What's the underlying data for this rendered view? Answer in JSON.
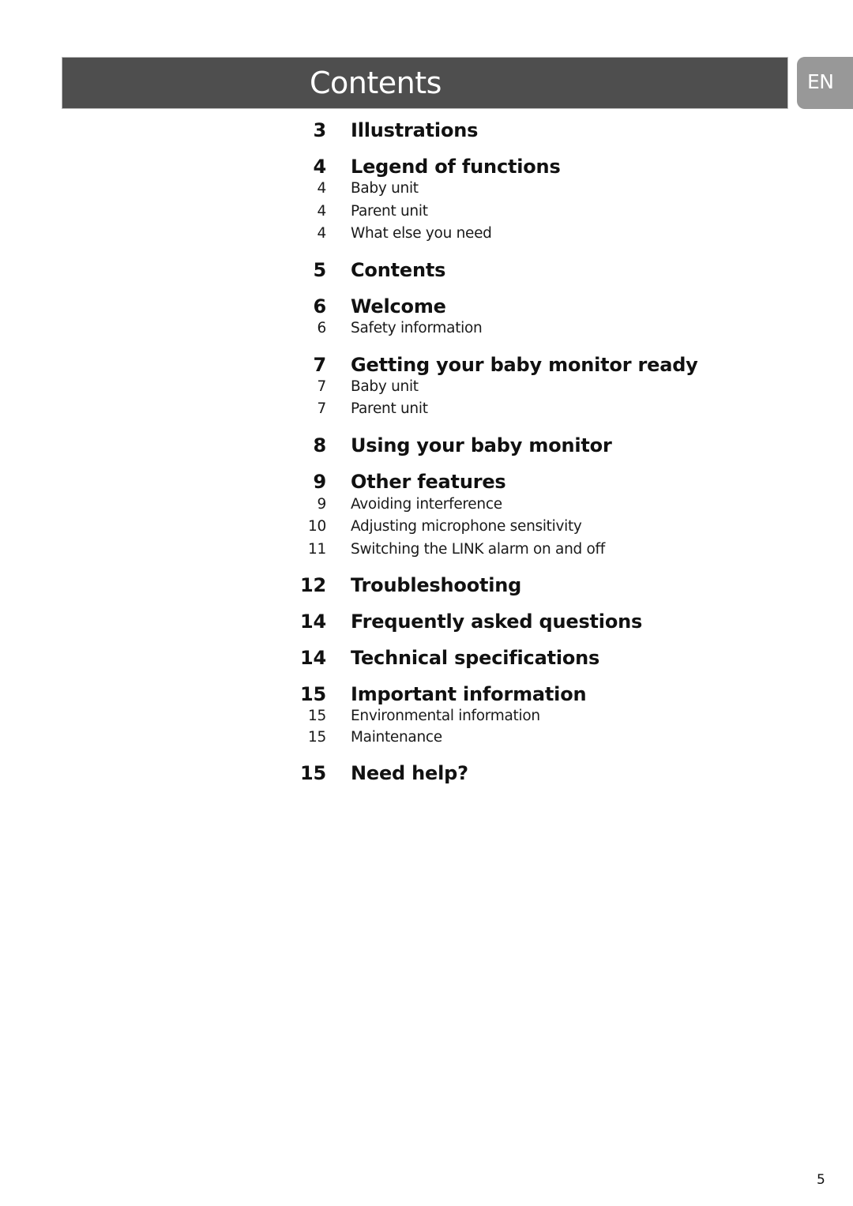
{
  "header": {
    "title": "Contents",
    "language_tab": "EN"
  },
  "toc": [
    {
      "type": "heading",
      "page": "3",
      "label": "Illustrations"
    },
    {
      "type": "heading",
      "page": "4",
      "label": "Legend of functions"
    },
    {
      "type": "sub",
      "page": "4",
      "label": "Baby unit"
    },
    {
      "type": "sub",
      "page": "4",
      "label": "Parent unit"
    },
    {
      "type": "sub",
      "page": "4",
      "label": "What else you need"
    },
    {
      "type": "heading",
      "page": "5",
      "label": "Contents"
    },
    {
      "type": "heading",
      "page": "6",
      "label": "Welcome"
    },
    {
      "type": "sub",
      "page": "6",
      "label": "Safety information"
    },
    {
      "type": "heading",
      "page": "7",
      "label": "Getting your baby monitor ready"
    },
    {
      "type": "sub",
      "page": "7",
      "label": "Baby unit"
    },
    {
      "type": "sub",
      "page": "7",
      "label": "Parent unit"
    },
    {
      "type": "heading",
      "page": "8",
      "label": "Using your baby monitor"
    },
    {
      "type": "heading",
      "page": "9",
      "label": "Other features"
    },
    {
      "type": "sub",
      "page": "9",
      "label": "Avoiding interference"
    },
    {
      "type": "sub",
      "page": "10",
      "label": "Adjusting microphone sensitivity"
    },
    {
      "type": "sub",
      "page": "11",
      "label": "Switching the LINK alarm on and off"
    },
    {
      "type": "heading",
      "page": "12",
      "label": "Troubleshooting"
    },
    {
      "type": "heading",
      "page": "14",
      "label": "Frequently asked questions"
    },
    {
      "type": "heading",
      "page": "14",
      "label": "Technical specifications"
    },
    {
      "type": "heading",
      "page": "15",
      "label": "Important information"
    },
    {
      "type": "sub",
      "page": "15",
      "label": "Environmental information"
    },
    {
      "type": "sub",
      "page": "15",
      "label": "Maintenance"
    },
    {
      "type": "heading",
      "page": "15",
      "label": "Need help?"
    }
  ],
  "footer": {
    "page_number": "5"
  }
}
